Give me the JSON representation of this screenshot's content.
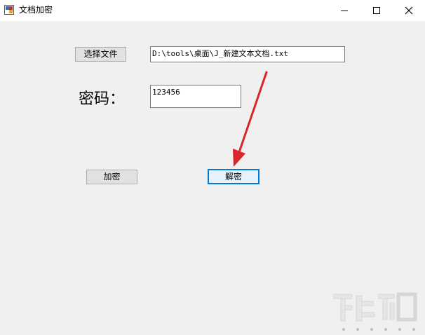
{
  "window": {
    "title": "文档加密"
  },
  "form": {
    "select_file_label": "选择文件",
    "file_path_value": "D:\\tools\\桌面\\J_新建文本文档.txt",
    "password_label": "密码：",
    "password_value": "123456",
    "encrypt_label": "加密",
    "decrypt_label": "解密"
  },
  "colors": {
    "window_bg": "#f0f0f0",
    "focus_border": "#0078d7",
    "arrow": "#d9252b"
  },
  "icons": {
    "app": "app-icon",
    "minimize": "minimize-icon",
    "maximize": "maximize-icon",
    "close": "close-icon",
    "annotation": "red-arrow-icon",
    "watermark": "watermark-logo"
  }
}
